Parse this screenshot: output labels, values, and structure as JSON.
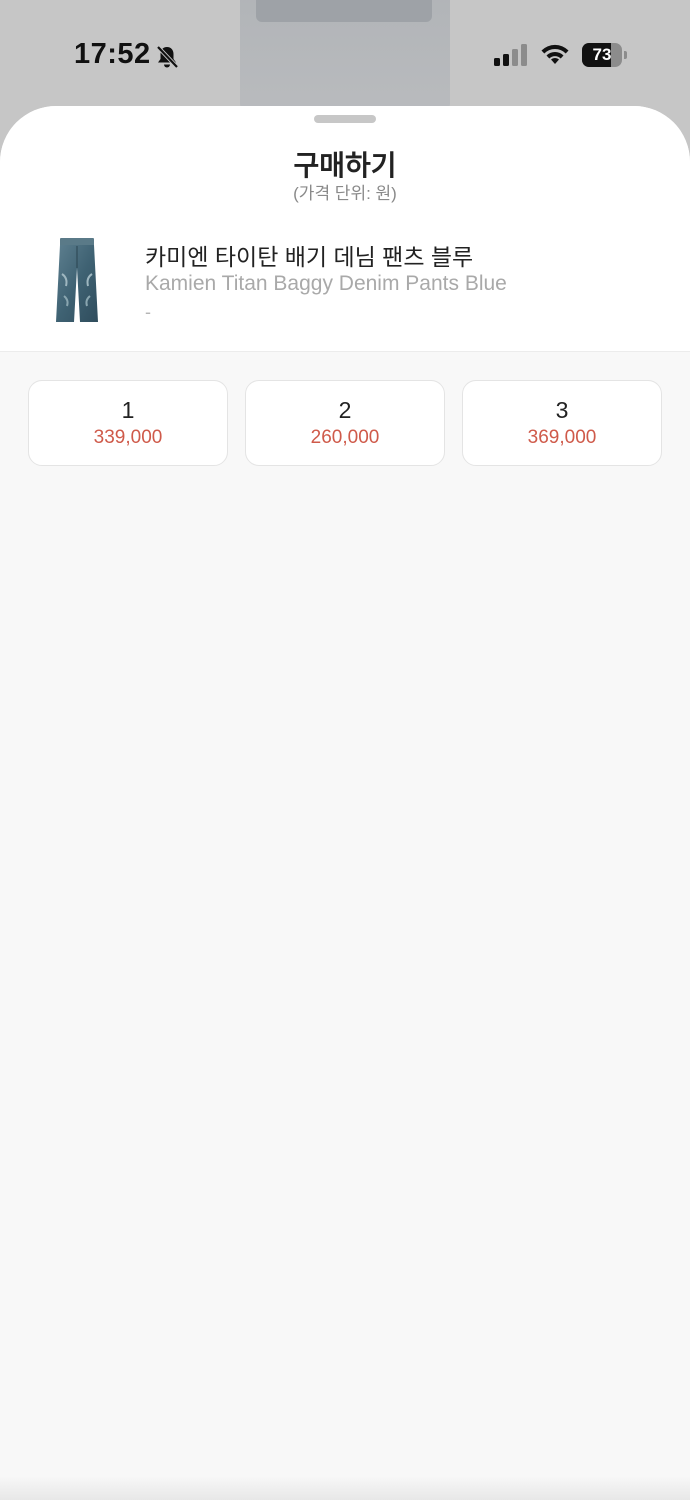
{
  "status_bar": {
    "time": "17:52",
    "battery_level": "73",
    "battery_fraction": 0.73,
    "icons": [
      "bell-slash-icon",
      "cellular-signal-icon",
      "wifi-icon",
      "battery-icon"
    ]
  },
  "sheet": {
    "title": "구매하기",
    "subtitle": "(가격 단위: 원)"
  },
  "product": {
    "name_ko": "카미엔 타이탄 배기 데님 팬츠 블루",
    "name_en": "Kamien Titan Baggy Denim Pants Blue",
    "extra": "-",
    "thumbnail_icon": "denim-pants-icon"
  },
  "sizes": [
    {
      "label": "1",
      "price": "339,000"
    },
    {
      "label": "2",
      "price": "260,000"
    },
    {
      "label": "3",
      "price": "369,000"
    }
  ],
  "colors": {
    "price_accent": "#cf5a4a",
    "sheet_background": "#f8f8f8",
    "overlay": "#c6c6c6"
  }
}
